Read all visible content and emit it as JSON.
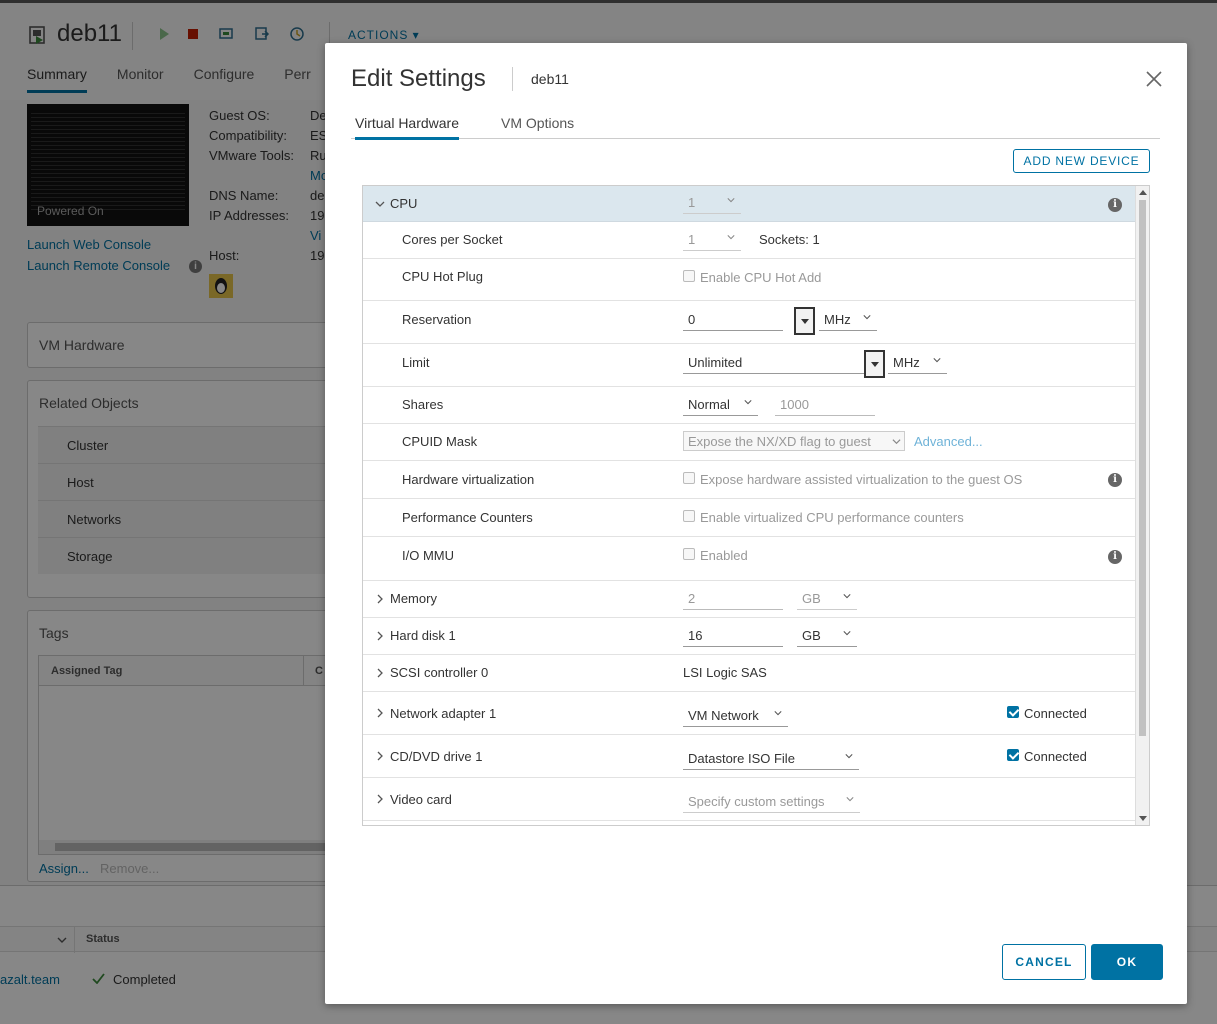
{
  "background": {
    "vm_name": "deb11",
    "actions_label": "ACTIONS",
    "tabs": [
      "Summary",
      "Monitor",
      "Configure",
      "Perr"
    ],
    "powered_on": "Powered On",
    "info_labels": [
      "Guest OS:",
      "Compatibility:",
      "VMware Tools:",
      "",
      "DNS Name:",
      "IP Addresses:",
      "",
      "Host:"
    ],
    "info_values": [
      "De",
      "ES",
      "Ru",
      "Mo",
      "de",
      "19",
      "Vi",
      "19"
    ],
    "launch_web": "Launch Web Console",
    "launch_remote": "Launch Remote Console",
    "vm_hardware": "VM Hardware",
    "related_objects": "Related Objects",
    "related_items": [
      "Cluster",
      "Host",
      "Networks",
      "Storage"
    ],
    "tags": "Tags",
    "assigned_tag": "Assigned Tag",
    "assigned_tag_col2": "C",
    "assign": "Assign...",
    "remove": "Remove...",
    "bottom_status_header": "Status",
    "bottom_target": "azalt.team",
    "bottom_status": "Completed"
  },
  "modal": {
    "title": "Edit Settings",
    "subtitle": "deb11",
    "tabs": [
      "Virtual Hardware",
      "VM Options"
    ],
    "active_tab": "Virtual Hardware",
    "add_device": "ADD NEW DEVICE",
    "cancel": "CANCEL",
    "ok": "OK"
  },
  "hardware": {
    "cpu": {
      "label": "CPU",
      "value": "1"
    },
    "cores_per_socket": {
      "label": "Cores per Socket",
      "value": "1",
      "sockets": "Sockets: 1"
    },
    "cpu_hot_plug": {
      "label": "CPU Hot Plug",
      "option": "Enable CPU Hot Add"
    },
    "reservation": {
      "label": "Reservation",
      "value": "0",
      "unit": "MHz"
    },
    "limit": {
      "label": "Limit",
      "value": "Unlimited",
      "unit": "MHz"
    },
    "shares": {
      "label": "Shares",
      "value": "Normal",
      "amount": "1000"
    },
    "cpuid_mask": {
      "label": "CPUID Mask",
      "value": "Expose the NX/XD flag to guest",
      "advanced": "Advanced..."
    },
    "hw_virt": {
      "label": "Hardware virtualization",
      "option": "Expose hardware assisted virtualization to the guest OS"
    },
    "perf_counters": {
      "label": "Performance Counters",
      "option": "Enable virtualized CPU performance counters"
    },
    "iommu": {
      "label": "I/O MMU",
      "option": "Enabled"
    },
    "memory": {
      "label": "Memory",
      "value": "2",
      "unit": "GB"
    },
    "hard_disk": {
      "label": "Hard disk 1",
      "value": "16",
      "unit": "GB"
    },
    "scsi": {
      "label": "SCSI controller 0",
      "value": "LSI Logic SAS"
    },
    "network": {
      "label": "Network adapter 1",
      "value": "VM Network",
      "connected": "Connected"
    },
    "cddvd": {
      "label": "CD/DVD drive 1",
      "value": "Datastore ISO File",
      "connected": "Connected"
    },
    "video": {
      "label": "Video card",
      "value": "Specify custom settings"
    }
  }
}
